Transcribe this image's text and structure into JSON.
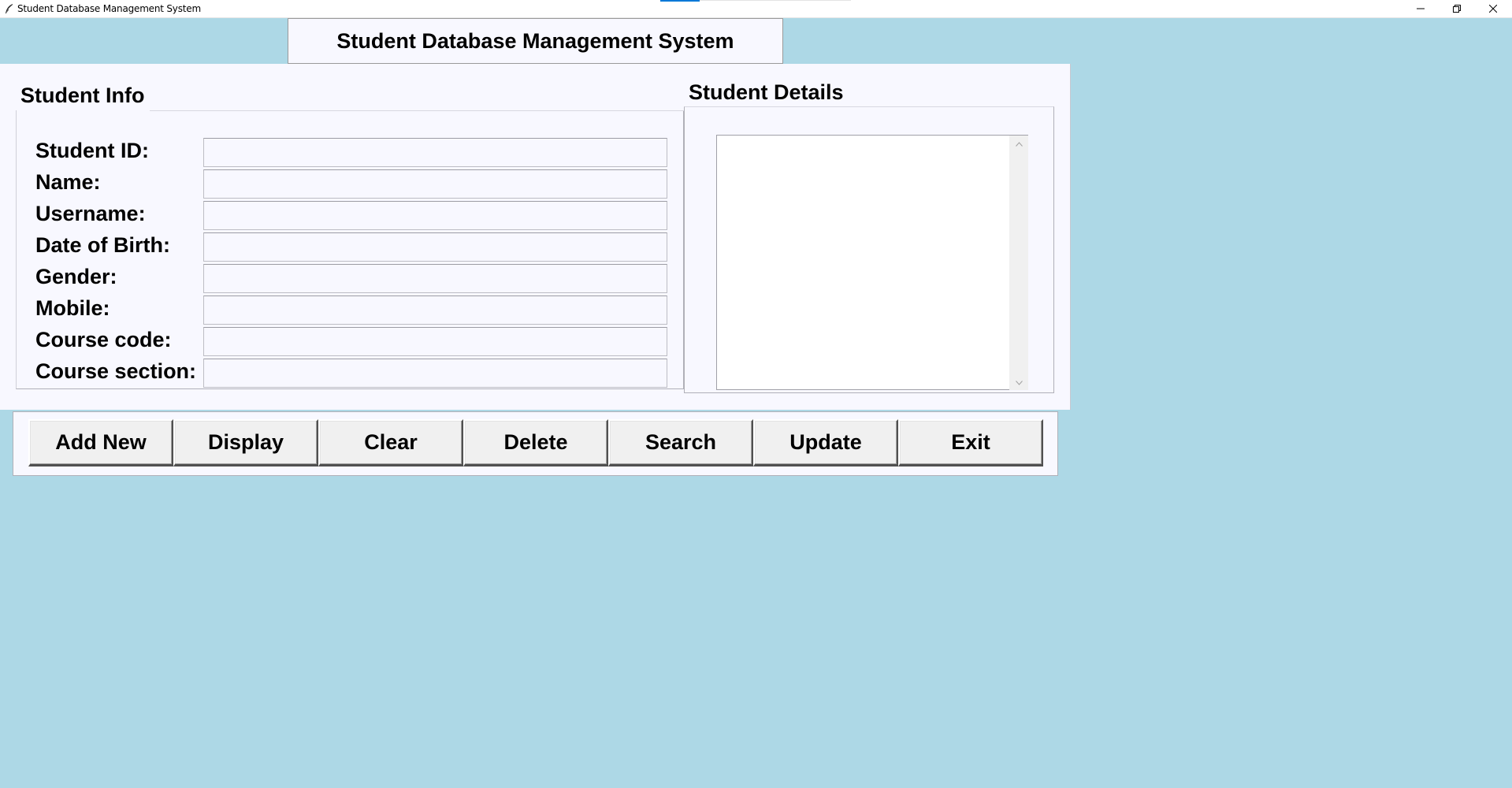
{
  "window": {
    "title": "Student Database Management System"
  },
  "header": {
    "title": "Student Database Management System"
  },
  "student_info": {
    "frame_title": "Student Info",
    "fields": [
      {
        "label": "Student ID:",
        "value": ""
      },
      {
        "label": "Name:",
        "value": ""
      },
      {
        "label": "Username:",
        "value": ""
      },
      {
        "label": "Date of Birth:",
        "value": ""
      },
      {
        "label": "Gender:",
        "value": ""
      },
      {
        "label": "Mobile:",
        "value": ""
      },
      {
        "label": "Course code:",
        "value": ""
      },
      {
        "label": "Course section:",
        "value": ""
      }
    ]
  },
  "student_details": {
    "frame_title": "Student Details",
    "items": []
  },
  "buttons": {
    "add_new": "Add New",
    "display": "Display",
    "clear": "Clear",
    "delete": "Delete",
    "search": "Search",
    "update": "Update",
    "exit": "Exit"
  },
  "colors": {
    "background": "#add8e6",
    "panel": "#f8f8ff",
    "button_face": "#f0f0f0"
  },
  "icons": {
    "app": "feather-icon",
    "minimize": "minimize-icon",
    "maximize": "restore-icon",
    "close": "close-icon"
  }
}
